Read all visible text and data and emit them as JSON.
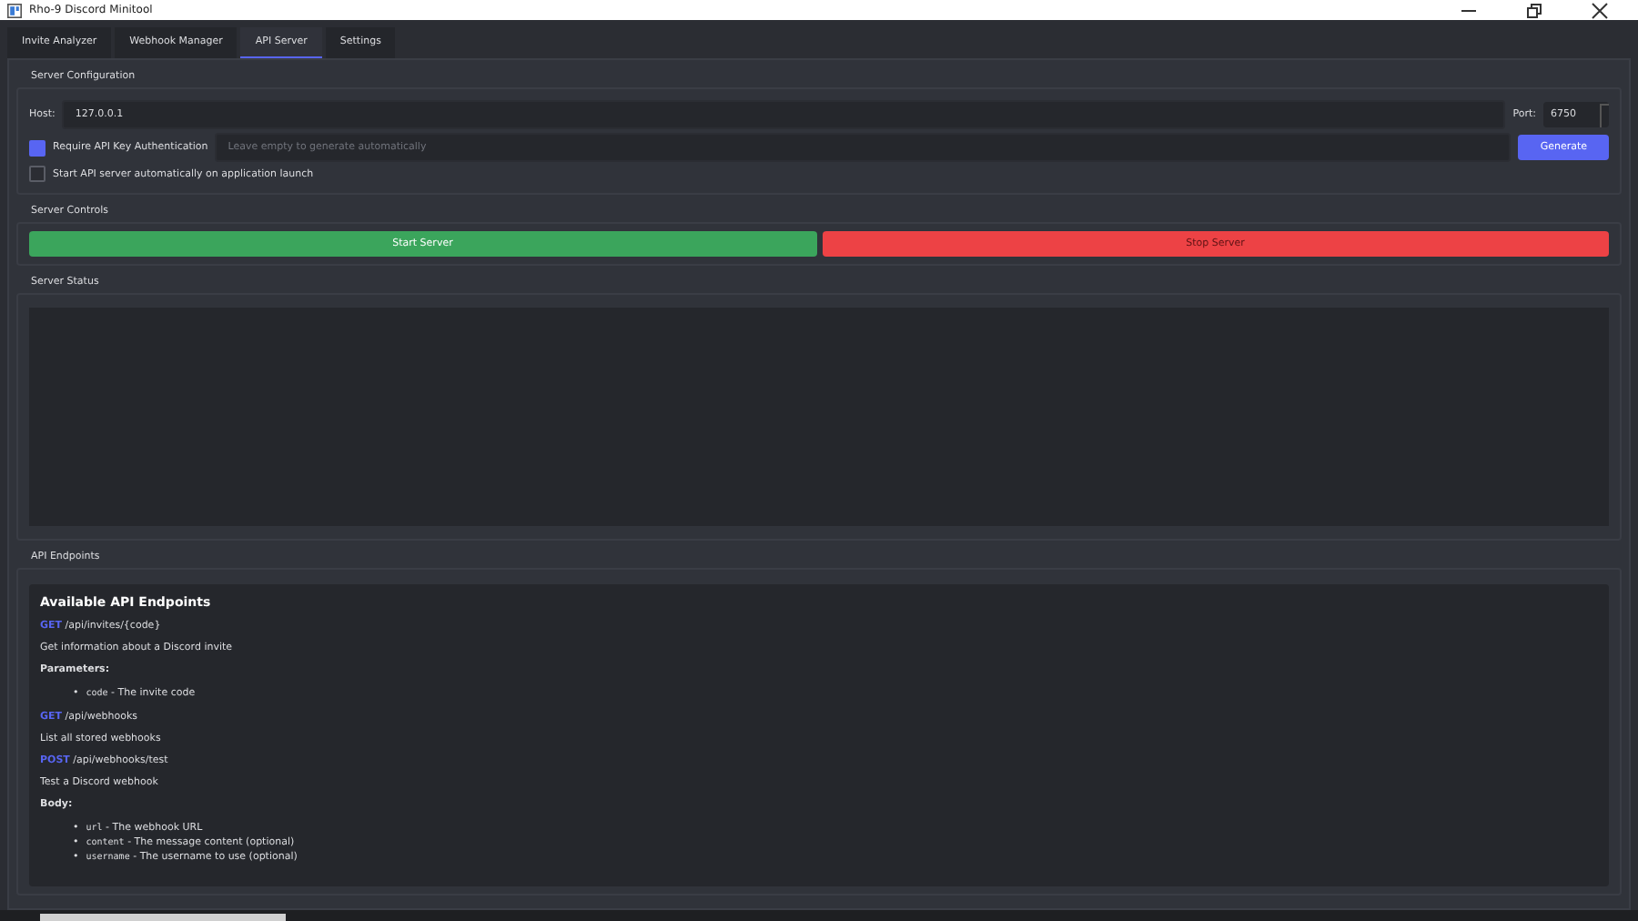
{
  "window": {
    "title": "Rho-9 Discord Minitool"
  },
  "tabs": [
    {
      "label": "Invite Analyzer",
      "selected": false
    },
    {
      "label": "Webhook Manager",
      "selected": false
    },
    {
      "label": "API Server",
      "selected": true
    },
    {
      "label": "Settings",
      "selected": false
    }
  ],
  "server_configuration": {
    "title": "Server Configuration",
    "host_label": "Host:",
    "host_value": "127.0.0.1",
    "port_label": "Port:",
    "port_value": "6750",
    "api_key_auth": {
      "label": "Require API Key Authentication",
      "checked": true
    },
    "api_key_field": {
      "placeholder": "Leave empty to generate automatically"
    },
    "generate_button": "Generate",
    "autostart": {
      "label": "Start API server automatically on application launch",
      "checked": false
    }
  },
  "server_controls": {
    "title": "Server Controls",
    "buttons": [
      {
        "label": "Start Server",
        "kind": "start",
        "disabled": false
      },
      {
        "label": "Stop Server",
        "kind": "stop",
        "disabled": true
      }
    ]
  },
  "server_status": {
    "title": "Server Status"
  },
  "api_endpoints": {
    "title": "API Endpoints",
    "heading": "Available API Endpoints",
    "endpoints": [
      {
        "method": "GET",
        "path": "/api/invites/{code}",
        "description": "Get information about a Discord invite",
        "params_heading": "Parameters:",
        "params": [
          {
            "bullet": "•",
            "name": "code",
            "description": "- The invite code"
          }
        ]
      },
      {
        "method": "GET",
        "path": "/api/webhooks",
        "description": "List all stored webhooks"
      },
      {
        "method": "POST",
        "path": "/api/webhooks/test",
        "description": "Test a Discord webhook",
        "params_heading": "Body:",
        "params": [
          {
            "bullet": "•",
            "name": "url",
            "description": "- The webhook URL"
          },
          {
            "bullet": "•",
            "name": "content",
            "description": "- The message content (optional)"
          },
          {
            "bullet": "•",
            "name": "username",
            "description": "- The username to use (optional)"
          }
        ]
      }
    ]
  }
}
